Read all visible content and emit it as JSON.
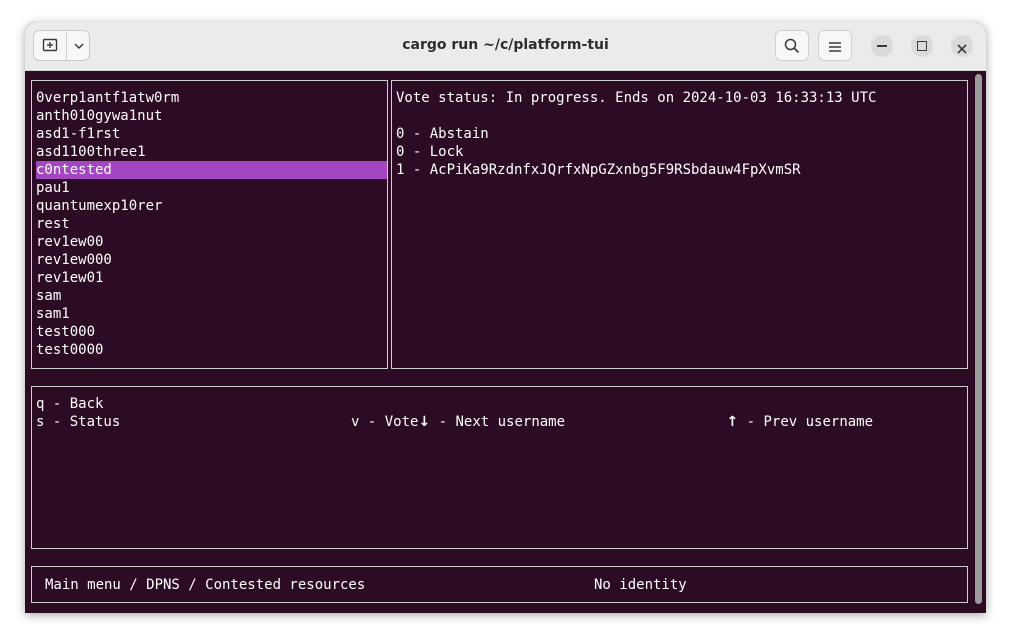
{
  "window": {
    "title": "cargo run ~/c/platform-tui"
  },
  "usernames": [
    "0verp1antf1atw0rm",
    "anth010gywa1nut",
    "asd1-f1rst",
    "asd1100three1",
    "c0ntested",
    "pau1",
    "quantumexp10rer",
    "rest",
    "rev1ew00",
    "rev1ew000",
    "rev1ew01",
    "sam",
    "sam1",
    "test000",
    "test0000"
  ],
  "selected_username": "c0ntested",
  "vote": {
    "status": "Vote status: In progress. Ends on 2024-10-03 16:33:13 UTC",
    "results": [
      "0 - Abstain",
      "0 - Lock",
      "1 - AcPiKa9RzdnfxJQrfxNpGZxnbg5F9RSbdauw4FpXvmSR"
    ]
  },
  "help": {
    "back": "q - Back",
    "status": "s - Status",
    "next_arrow": "↓",
    "next": " - Next username",
    "vote": "v - Vote",
    "prev_arrow": "↑",
    "prev": " - Prev username"
  },
  "statusbar": {
    "breadcrumb": "Main menu / DPNS / Contested resources",
    "identity": "No identity"
  },
  "colors": {
    "terminal_bg": "#2c0b24",
    "selection": "#a346c1",
    "border": "#cfcfcf",
    "text": "#ffffff"
  }
}
